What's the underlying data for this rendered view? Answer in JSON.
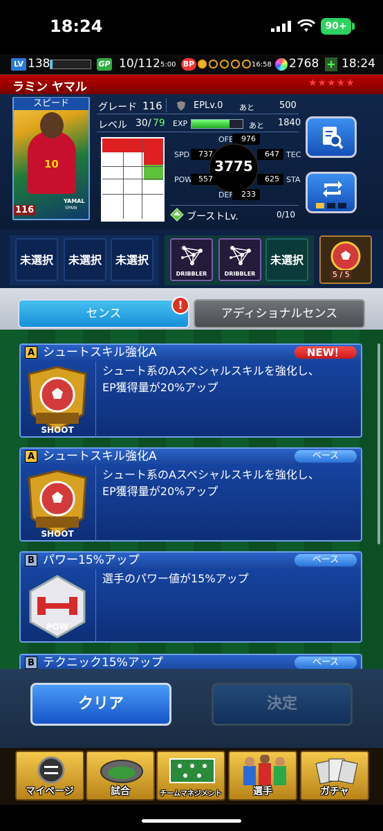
{
  "status_bar": {
    "time": "18:24",
    "battery": "90+"
  },
  "hud": {
    "lv_badge": "LV",
    "level": "138",
    "gp_badge": "GP",
    "gp": "10/112",
    "gp_timer": "5:00",
    "bp_badge": "BP",
    "bp_timer": "16:58",
    "gems": "2768",
    "plus": "+",
    "clock": "18:24"
  },
  "player": {
    "name": "ラミン ヤマル",
    "stars": "★★★★★",
    "card_type": "スピード",
    "card_number": "10",
    "card_rating": "116",
    "card_name": "YAMAL",
    "card_country": "SPAIN",
    "grade_label": "グレード",
    "grade": "116",
    "ep_label": "EPLv.0",
    "ep_remain_label": "あと",
    "ep_remain": "500",
    "level_label": "レベル",
    "level_current": "30",
    "level_max": "79",
    "exp_label": "EXP",
    "exp_progress": 0.74,
    "exp_remain_label": "あと",
    "exp_remain": "1840",
    "total": "3775",
    "stats": {
      "ofe_label": "OFE",
      "ofe": "976",
      "spd_label": "SPD",
      "spd": "737",
      "tec_label": "TEC",
      "tec": "647",
      "pow_label": "POW",
      "pow": "557",
      "sta_label": "STA",
      "sta": "625",
      "def_label": "DEF",
      "def": "233"
    },
    "boost_label": "ブーストLv.",
    "boost_value": "0/10"
  },
  "skill_slots": {
    "unselected_1": "未選択",
    "unselected_2": "未選択",
    "unselected_3": "未選択",
    "dribbler_1": "DRIBBLER",
    "dribbler_2": "DRIBBLER",
    "unselected_4": "未選択",
    "pack_count": "5 / 5"
  },
  "tabs": {
    "sense": "センス",
    "additional_sense": "アディショナルセンス",
    "alert": "!"
  },
  "senses": [
    {
      "grade": "A",
      "title": "シュートスキル強化A",
      "tag": "NEW！",
      "icon_label": "SHOOT",
      "desc_1": "シュート系のAスペシャルスキルを強化し、",
      "desc_2": "EP獲得量が20%アップ"
    },
    {
      "grade": "A",
      "title": "シュートスキル強化A",
      "tag": "ベース",
      "icon_label": "SHOOT",
      "desc_1": "シュート系のAスペシャルスキルを強化し、",
      "desc_2": "EP獲得量が20%アップ"
    },
    {
      "grade": "B",
      "title": "パワー15%アップ",
      "tag": "ベース",
      "icon_label": "POW",
      "desc_1": "選手のパワー値が15%アップ",
      "desc_2": ""
    },
    {
      "grade": "B",
      "title": "テクニック15%アップ",
      "tag": "ベース"
    }
  ],
  "buttons": {
    "clear": "クリア",
    "confirm": "決定"
  },
  "nav": {
    "mypage": "マイページ",
    "match": "試合",
    "team": "チームマネジメント",
    "players": "選手",
    "gacha": "ガチャ"
  },
  "colors": {
    "accent_blue": "#1690d8",
    "header_red": "#b00000",
    "new_red": "#c81a1a"
  }
}
